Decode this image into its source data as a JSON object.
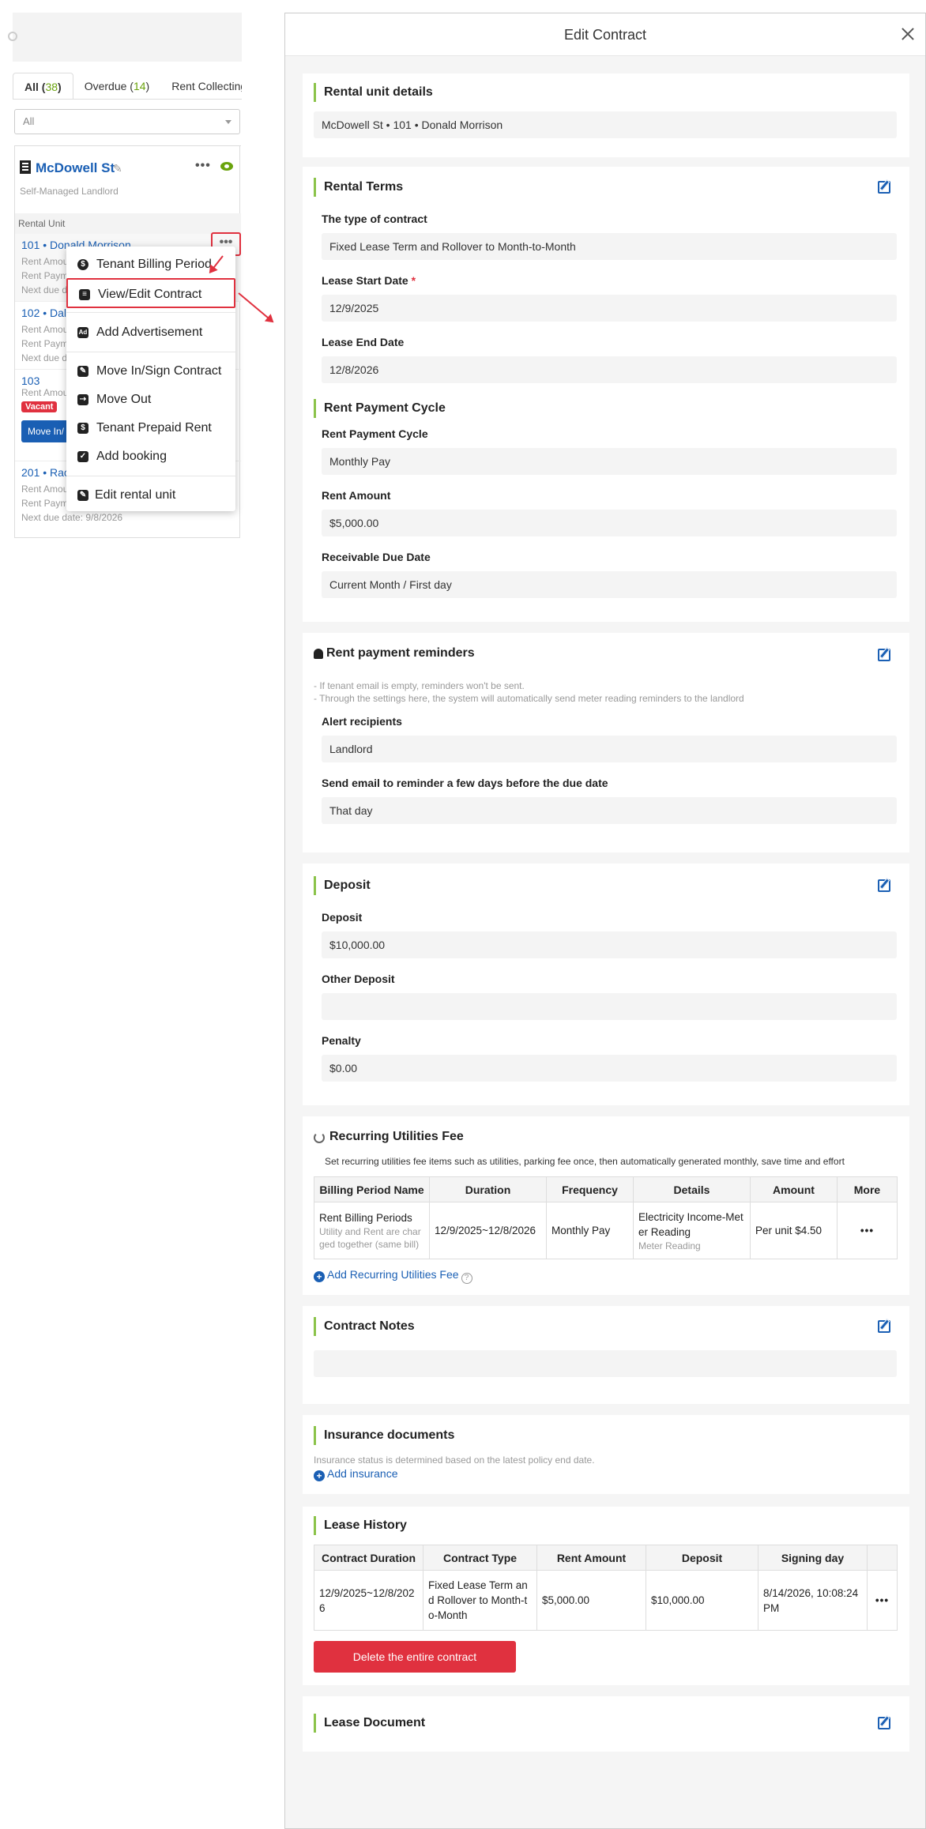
{
  "left": {
    "tabs": [
      {
        "label": "All",
        "count": "38"
      },
      {
        "label": "Overdue",
        "count": "14"
      },
      {
        "label": "Rent Collecting",
        "count": ""
      }
    ],
    "filter_value": "All",
    "property": {
      "name": "McDowell St",
      "subtitle": "Self-Managed Landlord",
      "more": "•••",
      "section_label": "Rental Unit"
    },
    "units": [
      {
        "title": "101 • Donald Morrison",
        "lines": [
          "Rent Amou",
          "Rent Paym",
          "Next due d"
        ]
      },
      {
        "title": "102 • Dale",
        "lines": [
          "Rent Amou",
          "Rent Paym",
          "Next due d"
        ]
      },
      {
        "title": "103",
        "lines": [
          "Rent Amou"
        ],
        "badge": "Vacant",
        "button": "Move In/"
      },
      {
        "title": "201 • Rac",
        "lines": [
          "Rent Amou",
          "Rent Paym",
          "Next due date: 9/8/2026"
        ]
      }
    ],
    "unit_more": "•••",
    "menu": [
      {
        "label": "Tenant Billing Period",
        "icon": "dollar-icon",
        "glyph": "$"
      },
      {
        "label": "View/Edit Contract",
        "icon": "document-icon",
        "glyph": "≡"
      },
      {
        "label": "Add Advertisement",
        "icon": "ad-icon",
        "glyph": "Ad"
      },
      {
        "label": "Move In/Sign Contract",
        "icon": "pen-icon",
        "glyph": "✎"
      },
      {
        "label": "Move Out",
        "icon": "walking-icon",
        "glyph": "⇢"
      },
      {
        "label": "Tenant Prepaid Rent",
        "icon": "prepaid-icon",
        "glyph": "$"
      },
      {
        "label": "Add booking",
        "icon": "calendar-check-icon",
        "glyph": "✓"
      },
      {
        "label": "Edit rental unit",
        "icon": "edit-icon",
        "glyph": "✎"
      }
    ]
  },
  "modal": {
    "title": "Edit Contract",
    "rental_unit": {
      "title": "Rental unit details",
      "value": "McDowell St • 101 • Donald Morrison"
    },
    "rental_terms": {
      "title": "Rental Terms",
      "contract_type_label": "The type of contract",
      "contract_type_value": "Fixed Lease Term and Rollover to Month-to-Month",
      "start_label": "Lease Start Date",
      "required_mark": "*",
      "start_value": "12/9/2025",
      "end_label": "Lease End Date",
      "end_value": "12/8/2026"
    },
    "payment_cycle": {
      "title": "Rent Payment Cycle",
      "cycle_label": "Rent Payment Cycle",
      "cycle_value": "Monthly Pay",
      "amount_label": "Rent Amount",
      "amount_value": "$5,000.00",
      "due_label": "Receivable Due Date",
      "due_value": "Current Month / First day"
    },
    "reminders": {
      "title": "Rent payment reminders",
      "note1": "- If tenant email is empty, reminders won't be sent.",
      "note2": "- Through the settings here, the system will automatically send meter reading reminders to the landlord",
      "recipients_label": "Alert recipients",
      "recipients_value": "Landlord",
      "days_label": "Send email to reminder a few days before the due date",
      "days_value": "That day"
    },
    "deposit": {
      "title": "Deposit",
      "deposit_label": "Deposit",
      "deposit_value": "$10,000.00",
      "other_label": "Other Deposit",
      "other_value": "",
      "penalty_label": "Penalty",
      "penalty_value": "$0.00"
    },
    "utilities": {
      "title": "Recurring Utilities Fee",
      "note": "Set recurring utilities fee items such as utilities, parking fee once, then automatically generated monthly, save time and effort",
      "headers": [
        "Billing Period Name",
        "Duration",
        "Frequency",
        "Details",
        "Amount",
        "More"
      ],
      "row": {
        "name": "Rent Billing Periods",
        "name_sub": "Utility and Rent are charged together (same bill)",
        "duration": "12/9/2025~12/8/2026",
        "frequency": "Monthly Pay",
        "details": "Electricity Income-Meter Reading",
        "details_sub": "Meter Reading",
        "amount": "Per unit $4.50",
        "more": "•••"
      },
      "add_link": "Add Recurring Utilities Fee"
    },
    "notes": {
      "title": "Contract Notes",
      "value": ""
    },
    "insurance": {
      "title": "Insurance documents",
      "note": "Insurance status is determined based on the latest policy end date.",
      "add_link": "Add insurance"
    },
    "history": {
      "title": "Lease History",
      "headers": [
        "Contract Duration",
        "Contract Type",
        "Rent Amount",
        "Deposit",
        "Signing day",
        ""
      ],
      "row": {
        "duration": "12/9/2025~12/8/2026",
        "type": "Fixed Lease Term and Rollover to Month-to-Month",
        "rent": "$5,000.00",
        "deposit": "$10,000.00",
        "signing": "8/14/2026, 10:08:24 PM",
        "more": "•••"
      },
      "delete_button": "Delete the entire contract"
    },
    "lease_document": {
      "title": "Lease Document"
    }
  },
  "colors": {
    "accent_green": "#8bc34a",
    "link_blue": "#1a5fb4",
    "danger_red": "#e0313f"
  }
}
